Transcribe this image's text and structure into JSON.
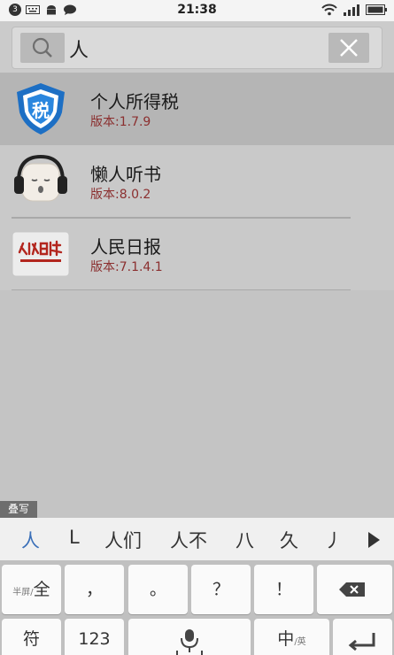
{
  "status_bar": {
    "notification_count": "3",
    "time": "21:38",
    "left_icons": [
      "keyboard-icon",
      "android-icon",
      "message-icon"
    ],
    "right_icons": [
      "wifi-icon",
      "signal-icon",
      "battery-icon"
    ]
  },
  "search": {
    "query": "人",
    "search_icon": "search-icon",
    "clear_icon": "close-icon"
  },
  "results": [
    {
      "name": "个人所得税",
      "version": "版本:1.7.9",
      "icon": "tax-shield-icon"
    },
    {
      "name": "懒人听书",
      "version": "版本:8.0.2",
      "icon": "headphones-face-icon"
    },
    {
      "name": "人民日报",
      "version": "版本:7.1.4.1",
      "icon": "peoples-daily-logo"
    }
  ],
  "handwriting_tab": "叠写",
  "candidates": [
    "人",
    "L",
    "人们",
    "人不",
    "八",
    "久",
    "丿"
  ],
  "keyboard": {
    "row1": {
      "halfwidth_small": "半屏/",
      "halfwidth_main": "全",
      "comma": "，",
      "period": "。",
      "question": "？",
      "exclaim": "！",
      "delete_icon": "backspace-icon"
    },
    "row2": {
      "symbols": "符",
      "numbers": "123",
      "space_icon": "microphone-icon",
      "lang_main": "中",
      "lang_sub": "/英",
      "enter_icon": "enter-icon"
    }
  },
  "colors": {
    "accent": "#3a6fb8",
    "version_text": "#8b2f2f",
    "tax_icon_blue": "#1d6fc4",
    "daily_red": "#b3261e"
  }
}
